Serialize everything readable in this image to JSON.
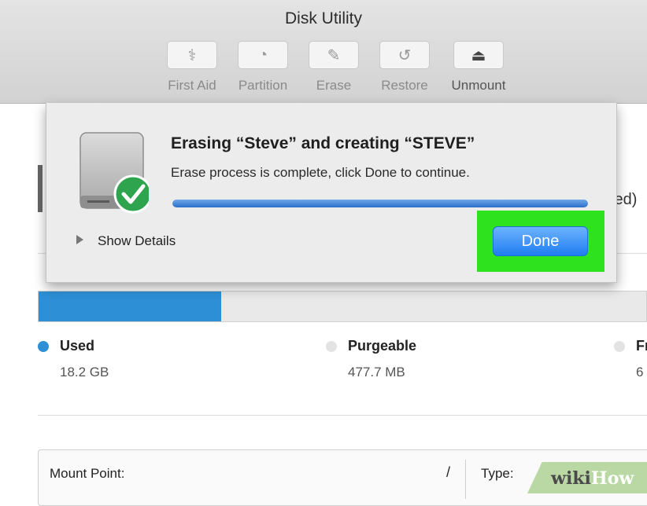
{
  "window": {
    "title": "Disk Utility"
  },
  "toolbar": [
    {
      "label": "First Aid",
      "icon": "stethoscope-icon",
      "glyph": "⚕",
      "active": false
    },
    {
      "label": "Partition",
      "icon": "partition-icon",
      "glyph": "◔",
      "active": false
    },
    {
      "label": "Erase",
      "icon": "erase-icon",
      "glyph": "✎",
      "active": false
    },
    {
      "label": "Restore",
      "icon": "restore-icon",
      "glyph": "↺",
      "active": false
    },
    {
      "label": "Unmount",
      "icon": "unmount-icon",
      "glyph": "⏏",
      "active": true
    }
  ],
  "dialog": {
    "title": "Erasing “Steve” and creating “STEVE”",
    "message": "Erase process is complete, click Done to continue.",
    "progress": 1.0,
    "show_details": "Show Details",
    "done_button": "Done",
    "highlight_color": "#2fe21e"
  },
  "background": {
    "partial_text": "led)",
    "usage": {
      "used_fraction": 0.3,
      "used": {
        "label": "Used",
        "value": "18.2 GB",
        "color": "#2d8fd6"
      },
      "purgeable": {
        "label": "Purgeable",
        "value": "477.7 MB",
        "color": "#e3e3e3"
      },
      "free": {
        "label": "Fr",
        "value": "6",
        "color": "#e3e3e3"
      }
    },
    "info": {
      "mount_point_label": "Mount Point:",
      "mount_point_value": "/",
      "type_label": "Type:"
    }
  },
  "watermark": {
    "part1": "wiki",
    "part2": "How"
  }
}
